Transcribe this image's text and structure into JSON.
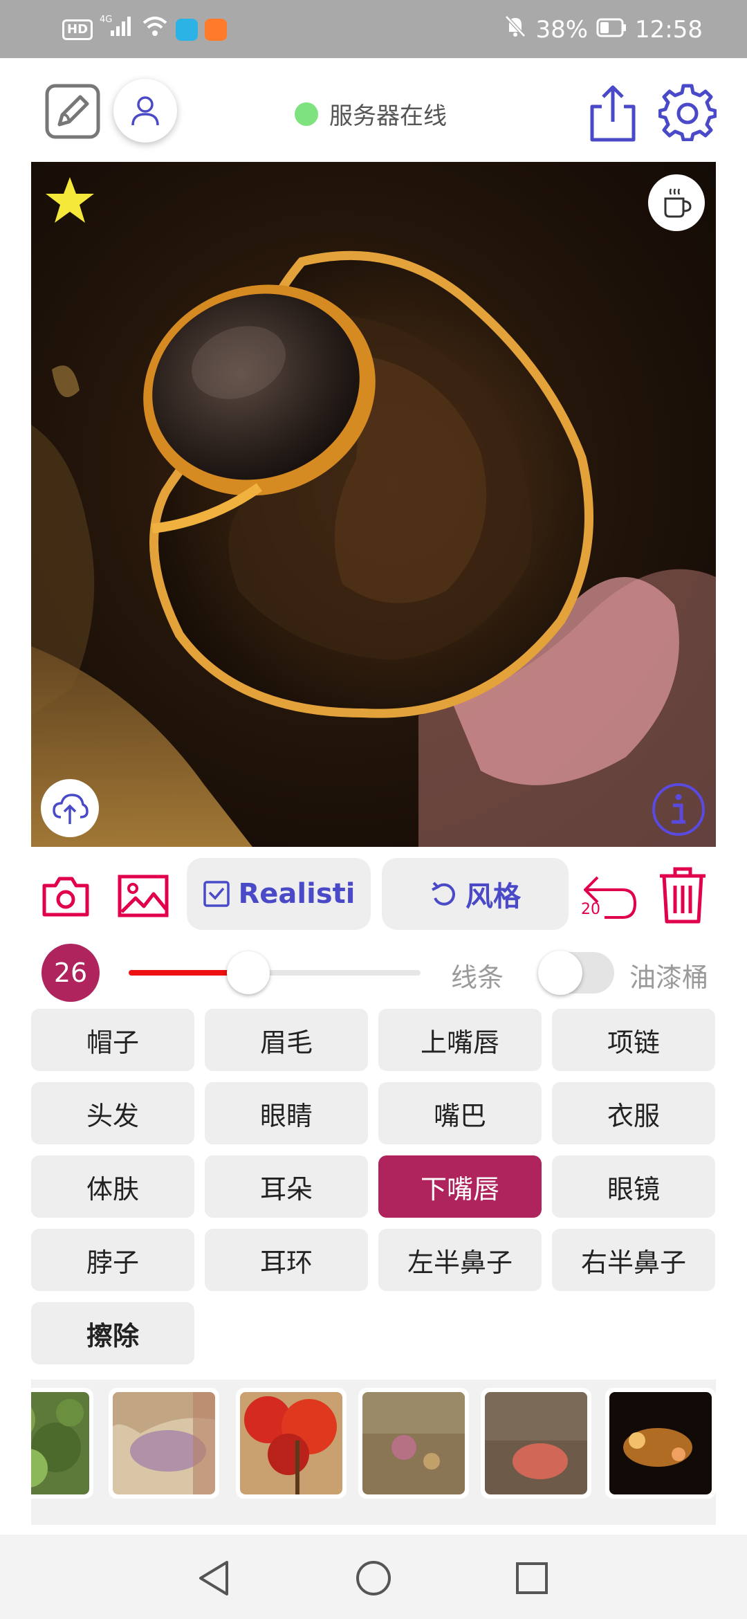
{
  "status_bar": {
    "network_badge": "HD",
    "network_type": "4G",
    "battery": "38%",
    "time": "12:58"
  },
  "header": {
    "server_status": "服务器在线",
    "server_status_color": "#7ee27e",
    "accent_color": "#4a4ac8"
  },
  "canvas": {
    "favorite_icon": "star-icon",
    "top_right_icon": "coffee-cup-icon",
    "bottom_left_icon": "cloud-upload-icon",
    "bottom_right_icon": "info-icon"
  },
  "toolbar": {
    "model_label": "Realisti",
    "style_label": "风格",
    "undo_count": "20",
    "accent_color": "#e0004e"
  },
  "brush": {
    "size": "26",
    "slider_fraction": 0.41,
    "line_label": "线条",
    "bucket_label": "油漆桶",
    "bucket_enabled": false
  },
  "parts": [
    {
      "label": "帽子",
      "active": false
    },
    {
      "label": "眉毛",
      "active": false
    },
    {
      "label": "上嘴唇",
      "active": false
    },
    {
      "label": "项链",
      "active": false
    },
    {
      "label": "头发",
      "active": false
    },
    {
      "label": "眼睛",
      "active": false
    },
    {
      "label": "嘴巴",
      "active": false
    },
    {
      "label": "衣服",
      "active": false
    },
    {
      "label": "体肤",
      "active": false
    },
    {
      "label": "耳朵",
      "active": false
    },
    {
      "label": "下嘴唇",
      "active": true
    },
    {
      "label": "眼镜",
      "active": false
    },
    {
      "label": "脖子",
      "active": false
    },
    {
      "label": "耳环",
      "active": false
    },
    {
      "label": "左半鼻子",
      "active": false
    },
    {
      "label": "右半鼻子",
      "active": false
    },
    {
      "label": "擦除",
      "active": false
    }
  ],
  "active_part_color": "#b0245e",
  "nav": {
    "back_icon": "back-triangle-icon",
    "home_icon": "home-circle-icon",
    "recents_icon": "recents-square-icon"
  }
}
